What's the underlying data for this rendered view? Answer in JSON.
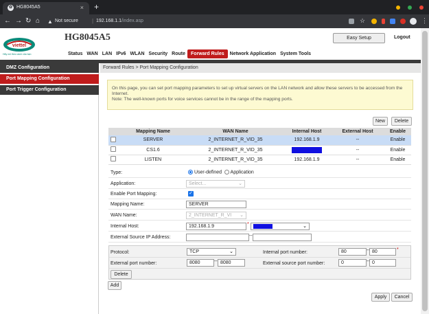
{
  "browser": {
    "tab_title": "HG8045A5",
    "new_tab": "+",
    "security_label": "Not secure",
    "url_host": "192.168.1.1",
    "url_path": "/index.asp"
  },
  "header": {
    "logo_text": "viettel",
    "logo_slogan": "Hãy nói theo cách của bạn",
    "model": "HG8045A5",
    "easy_setup": "Easy Setup",
    "logout": "Logout"
  },
  "menu": [
    "Status",
    "WAN",
    "LAN",
    "IPv6",
    "WLAN",
    "Security",
    "Route",
    "Forward Rules",
    "Network Application",
    "System Tools"
  ],
  "menu_active": "Forward Rules",
  "sidebar": {
    "items": [
      {
        "label": "DMZ Configuration"
      },
      {
        "label": "Port Mapping Configuration"
      },
      {
        "label": "Port Trigger Configuration"
      }
    ]
  },
  "breadcrumb": "Forward Rules > Port Mapping Configuration",
  "info": {
    "line1": "On this page, you can set port mapping parameters to set up virtual servers on the LAN network and allow these servers to be accessed from the Internet.",
    "line2": "Note: The well-known ports for voice services cannot be in the range of the mapping ports."
  },
  "table_buttons": {
    "new": "New",
    "delete": "Delete"
  },
  "table": {
    "headers": [
      "",
      "Mapping Name",
      "WAN Name",
      "Internal Host",
      "External Host",
      "Enable"
    ],
    "rows": [
      {
        "name": "SERVER",
        "wan": "2_INTERNET_R_VID_35",
        "internal": "192.168.1.9",
        "external": "--",
        "enable": "Enable"
      },
      {
        "name": "CS1.6",
        "wan": "2_INTERNET_R_VID_35",
        "internal": "",
        "external": "--",
        "enable": "Enable"
      },
      {
        "name": "LISTEN",
        "wan": "2_INTERNET_R_VID_35",
        "internal": "192.168.1.9",
        "external": "--",
        "enable": "Enable"
      }
    ]
  },
  "form": {
    "type_label": "Type:",
    "type_opt1": "User-defined",
    "type_opt2": "Application",
    "application_label": "Application:",
    "application_placeholder": "Select...",
    "enable_label": "Enable Port Mapping:",
    "mapping_name_label": "Mapping Name:",
    "mapping_name_value": "SERVER",
    "wan_name_label": "WAN Name:",
    "wan_name_value": "2_INTERNET_R_VI",
    "internal_host_label": "Internal Host:",
    "internal_host_value": "192.168.1.9",
    "ext_src_ip_label": "External Source IP Address:",
    "required_mark": "*",
    "dash": "--"
  },
  "ports": {
    "protocol_label": "Protocol:",
    "protocol_value": "TCP",
    "internal_port_label": "Internal port number:",
    "internal_port_from": "80",
    "internal_port_to": "80",
    "external_port_label": "External port number:",
    "external_port_from": "8080",
    "external_port_to": "8080",
    "ext_src_port_label": "External source port number:",
    "ext_src_port_from": "0",
    "ext_src_port_to": "0",
    "delete": "Delete"
  },
  "bottom": {
    "add": "Add",
    "apply": "Apply",
    "cancel": "Cancel"
  },
  "colors": {
    "accent_red": "#c01c1c",
    "highlight_blue": "#1010e0",
    "selected_row": "#c8dcf6"
  }
}
